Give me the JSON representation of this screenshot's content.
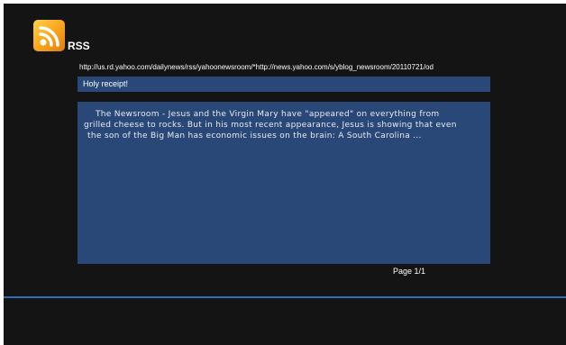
{
  "header": {
    "title": "RSS",
    "icon": "rss-feed-icon"
  },
  "feed": {
    "url": "http://us.rd.yahoo.com/dailynews/rss/yahoonewsroom/*http://news.yahoo.com/s/yblog_newsroom/20110721/od"
  },
  "item": {
    "headline": "Holy receipt!",
    "body_lines": [
      "The Newsroom - Jesus and the Virgin Mary have \"appeared\" on everything from",
      "grilled cheese to rocks. But in his most recent appearance, Jesus is showing that even",
      "the son of the Big Man has economic issues on the brain: A South Carolina ..."
    ]
  },
  "pager": {
    "label": "Page 1/1"
  },
  "colors": {
    "background": "#141414",
    "panel": "#294878",
    "divider": "#2d6db8",
    "icon_orange": "#f7a21b"
  }
}
